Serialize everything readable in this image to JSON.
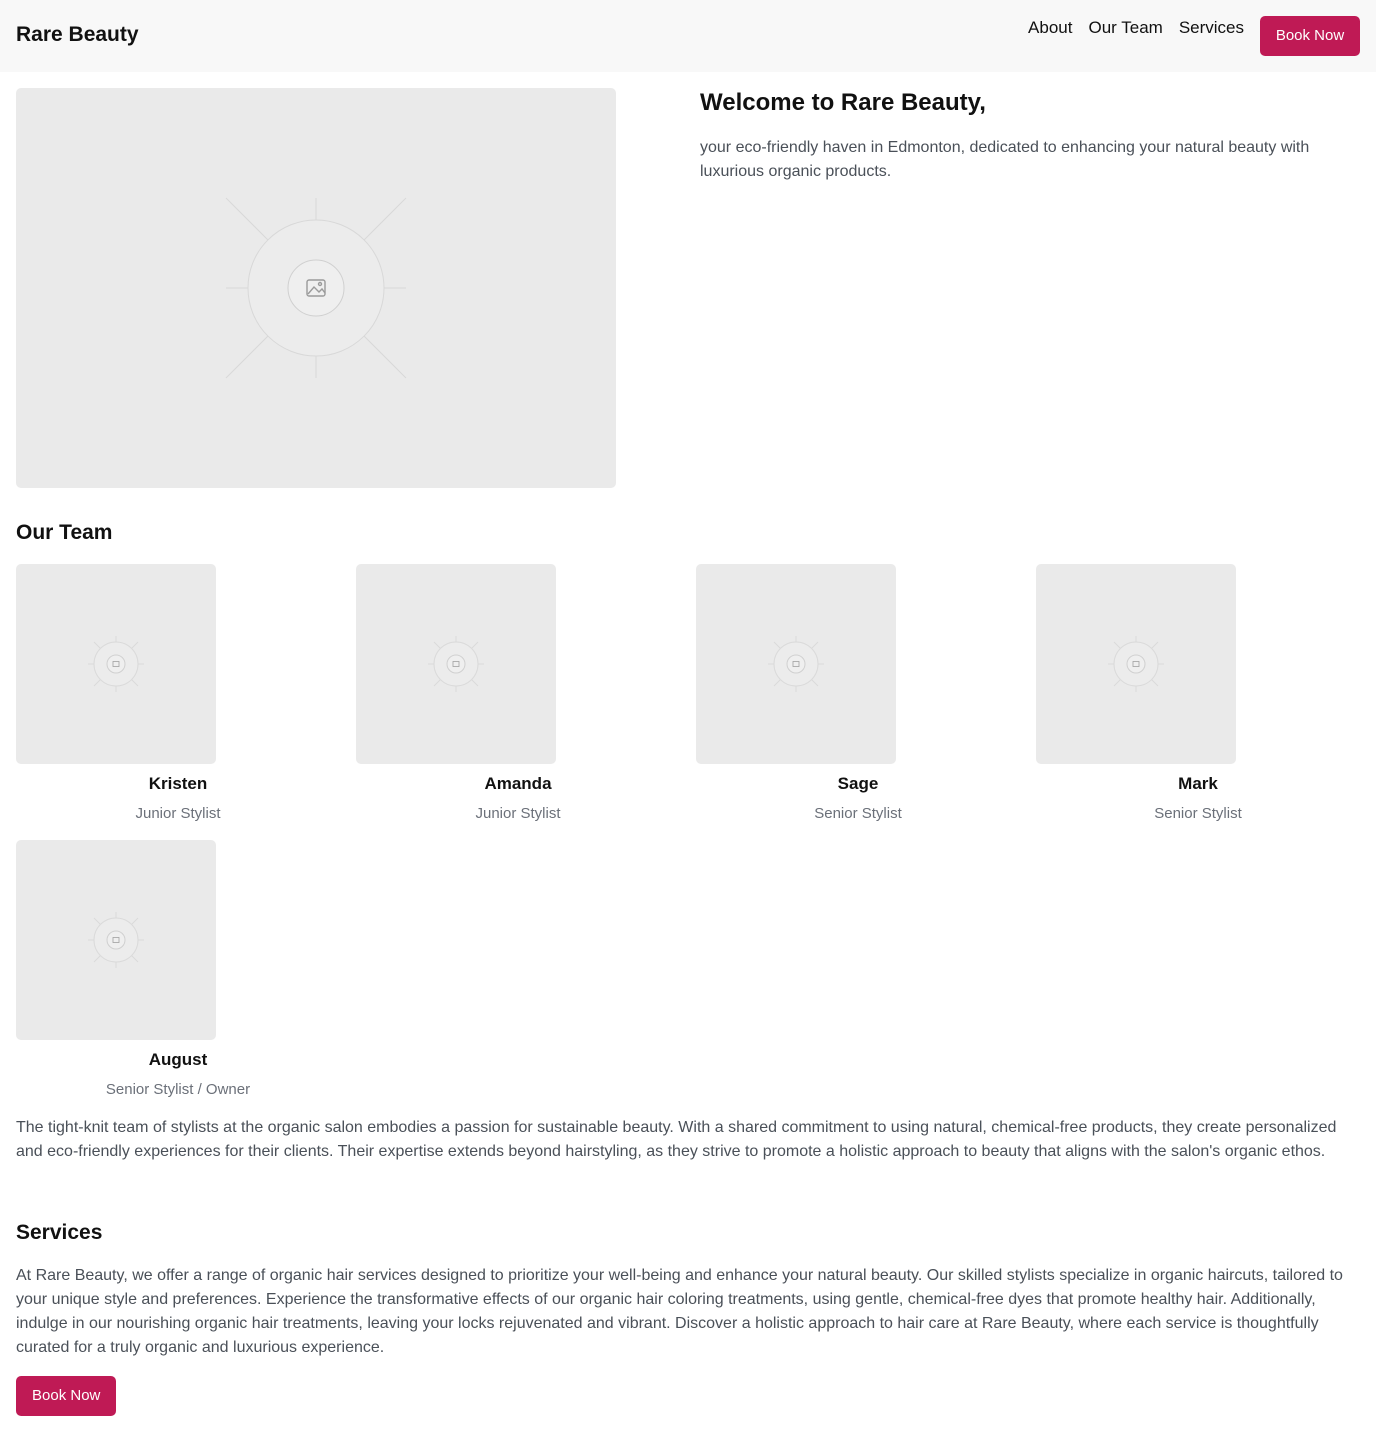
{
  "header": {
    "brand": "Rare Beauty",
    "nav": [
      "About",
      "Our Team",
      "Services"
    ],
    "cta_label": "Book Now"
  },
  "hero": {
    "image_icon": "image-placeholder-icon",
    "title": "Welcome to Rare Beauty,",
    "text": "your eco-friendly haven in Edmonton, dedicated to enhancing your natural beauty with luxurious organic products."
  },
  "team": {
    "title": "Our Team",
    "members": [
      {
        "name": "Kristen",
        "role": "Junior Stylist"
      },
      {
        "name": "Amanda",
        "role": "Junior Stylist"
      },
      {
        "name": "Sage",
        "role": "Senior Stylist"
      },
      {
        "name": "Mark",
        "role": "Senior Stylist"
      },
      {
        "name": "August",
        "role": "Senior Stylist / Owner"
      }
    ],
    "description": "The tight-knit team of stylists at the organic salon embodies a passion for sustainable beauty. With a shared commitment to using natural, chemical-free products, they create personalized and eco-friendly experiences for their clients. Their expertise extends beyond hairstyling, as they strive to promote a holistic approach to beauty that aligns with the salon's organic ethos."
  },
  "services": {
    "title": "Services",
    "text": "At Rare Beauty, we offer a range of organic hair services designed to prioritize your well-being and enhance your natural beauty. Our skilled stylists specialize in organic haircuts, tailored to your unique style and preferences. Experience the transformative effects of our organic hair coloring treatments, using gentle, chemical-free dyes that promote healthy hair. Additionally, indulge in our nourishing organic hair treatments, leaving your locks rejuvenated and vibrant. Discover a holistic approach to hair care at Rare Beauty, where each service is thoughtfully curated for a truly organic and luxurious experience.",
    "cta_label": "Book Now"
  },
  "colors": {
    "accent": "#bf1a55",
    "header_bg": "#f8f8f8",
    "placeholder_bg": "#eaeaea"
  }
}
